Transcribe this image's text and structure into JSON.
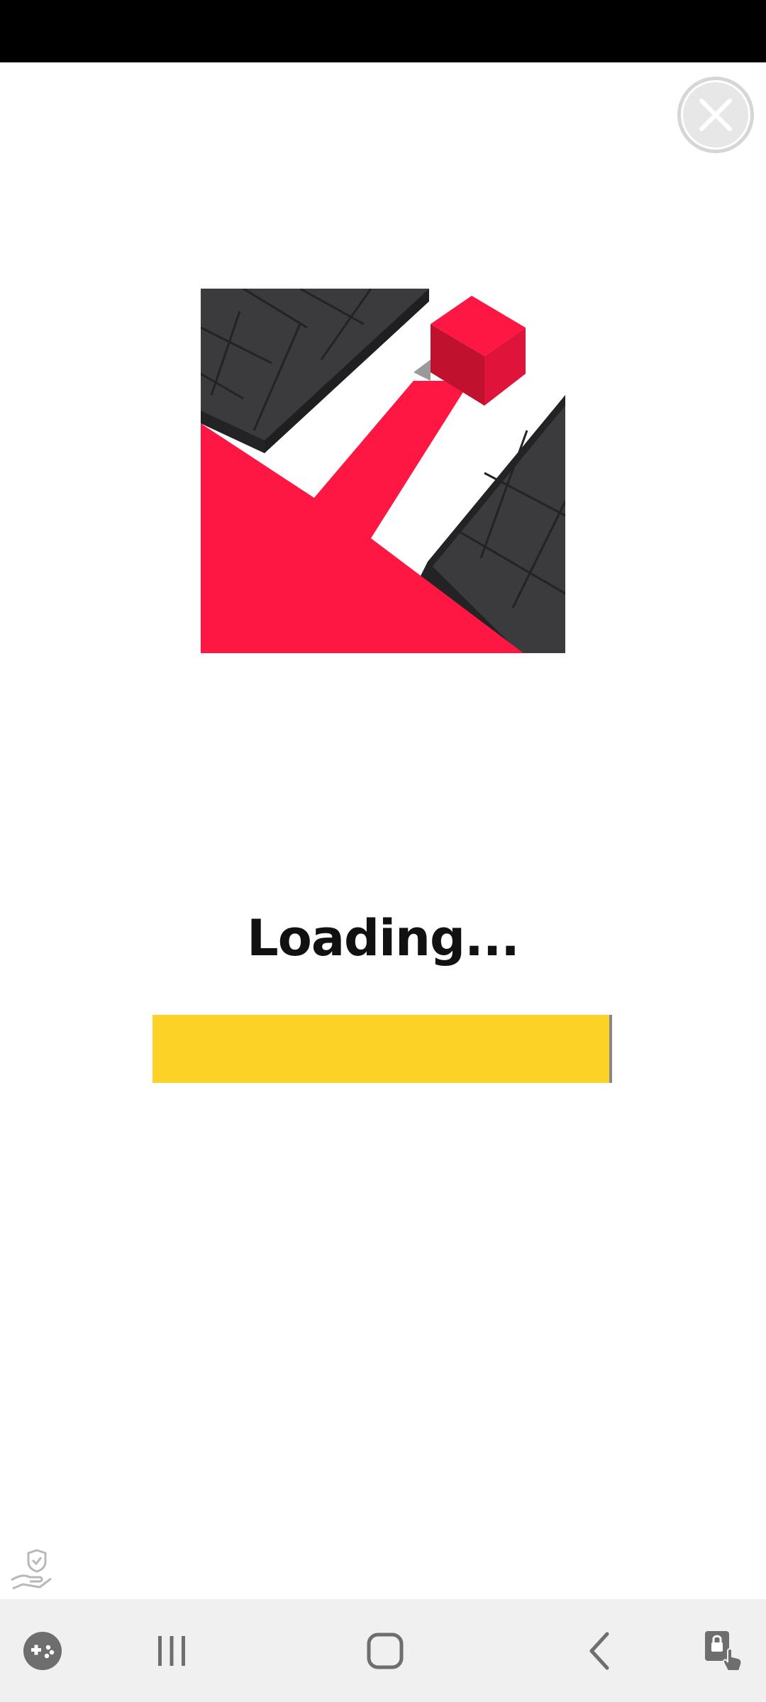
{
  "loading": {
    "label": "Loading...",
    "progress_fraction": 1.0
  },
  "colors": {
    "progress_fill": "#fcd226",
    "icon_red": "#ff1744",
    "icon_dark": "#3b3b3d",
    "nav_bg": "#f0f0f0"
  },
  "icons": {
    "close": "close-icon",
    "ad_choices": "hand-shield-icon",
    "game_tools": "gamepad-plus-icon",
    "recents": "recents-icon",
    "home": "home-icon",
    "back": "back-icon",
    "screen_lock": "screen-touch-lock-icon"
  }
}
